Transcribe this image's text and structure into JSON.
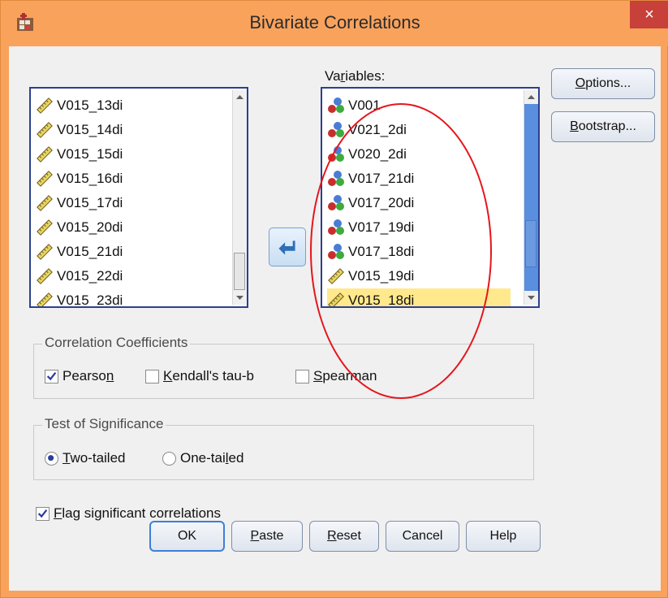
{
  "window": {
    "title": "Bivariate Correlations",
    "close_glyph": "×"
  },
  "source_list": {
    "items": [
      {
        "label": "V015_13di",
        "icon": "scale-ruler-icon"
      },
      {
        "label": "V015_14di",
        "icon": "scale-ruler-icon"
      },
      {
        "label": "V015_15di",
        "icon": "scale-ruler-icon"
      },
      {
        "label": "V015_16di",
        "icon": "scale-ruler-icon"
      },
      {
        "label": "V015_17di",
        "icon": "scale-ruler-icon"
      },
      {
        "label": "V015_20di",
        "icon": "scale-ruler-icon"
      },
      {
        "label": "V015_21di",
        "icon": "scale-ruler-icon"
      },
      {
        "label": "V015_22di",
        "icon": "scale-ruler-icon"
      },
      {
        "label": "V015_23di",
        "icon": "scale-ruler-icon"
      }
    ]
  },
  "variables_list": {
    "label_prefix": "Va",
    "label_mnemonic": "r",
    "label_rest": "iables:",
    "items": [
      {
        "label": "V001",
        "icon": "nominal-balls-icon"
      },
      {
        "label": "V021_2di",
        "icon": "nominal-balls-icon"
      },
      {
        "label": "V020_2di",
        "icon": "nominal-balls-icon"
      },
      {
        "label": "V017_21di",
        "icon": "nominal-balls-icon"
      },
      {
        "label": "V017_20di",
        "icon": "nominal-balls-icon"
      },
      {
        "label": "V017_19di",
        "icon": "nominal-balls-icon"
      },
      {
        "label": "V017_18di",
        "icon": "nominal-balls-icon"
      },
      {
        "label": "V015_19di",
        "icon": "scale-ruler-icon"
      },
      {
        "label": "V015_18di",
        "icon": "scale-ruler-icon",
        "selected": true
      }
    ]
  },
  "side_buttons": {
    "options_mnemonic": "O",
    "options_rest": "ptions...",
    "bootstrap_mnemonic": "B",
    "bootstrap_rest": "ootstrap..."
  },
  "correlation_coefficients": {
    "title": "Correlation Coefficients",
    "pearson_a": "Pearso",
    "pearson_m": "n",
    "pearson_checked": true,
    "kendall_m": "K",
    "kendall_rest": "endall's tau-b",
    "kendall_checked": false,
    "spearman_m": "S",
    "spearman_rest": "pearman",
    "spearman_checked": false
  },
  "test_of_significance": {
    "title": "Test of Significance",
    "two_m": "T",
    "two_rest": "wo-tailed",
    "two_selected": true,
    "one_a": "One-tai",
    "one_m": "l",
    "one_rest": "ed",
    "one_selected": false
  },
  "flag": {
    "m": "F",
    "rest": "lag significant correlations",
    "checked": true
  },
  "footer_buttons": {
    "ok": "OK",
    "paste_m": "P",
    "paste_rest": "aste",
    "reset_m": "R",
    "reset_rest": "eset",
    "cancel": "Cancel",
    "help": "Help"
  },
  "colors": {
    "titlebar": "#f9a25c",
    "list_border": "#2d3f8f",
    "selected_row": "#ffe98c",
    "annotation": "#e5151c",
    "check": "#2b3a9e"
  }
}
